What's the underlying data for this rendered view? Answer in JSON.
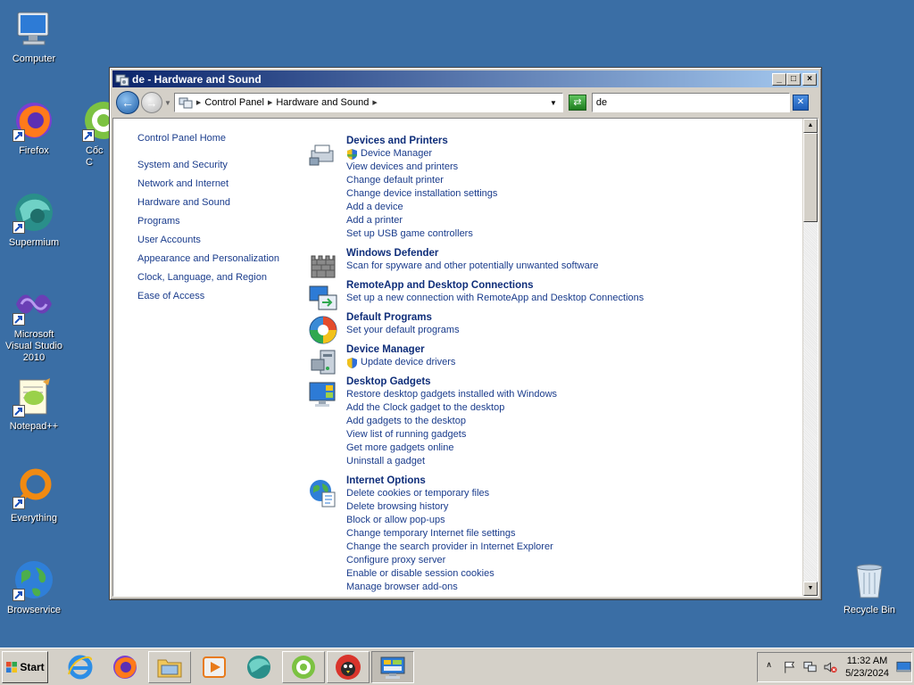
{
  "desktop": {
    "icons": [
      {
        "label": "Computer"
      },
      {
        "label": "Firefox"
      },
      {
        "label": "Cốc C"
      },
      {
        "label": "Supermium"
      },
      {
        "label": "Microsoft Visual Studio 2010"
      },
      {
        "label": "Notepad++"
      },
      {
        "label": "Everything"
      },
      {
        "label": "Browservice"
      },
      {
        "label": "Recycle Bin"
      }
    ]
  },
  "window": {
    "title": "de - Hardware and Sound",
    "controls": {
      "minimize": "_",
      "maximize": "□",
      "close": "×"
    },
    "address": {
      "crumbs": [
        "Control Panel",
        "Hardware and Sound"
      ]
    },
    "search": {
      "value": "de"
    },
    "leftnav": {
      "home": "Control Panel Home",
      "items": [
        "System and Security",
        "Network and Internet",
        "Hardware and Sound",
        "Programs",
        "User Accounts",
        "Appearance and Personalization",
        "Clock, Language, and Region",
        "Ease of Access"
      ]
    },
    "results": [
      {
        "title": "Devices and Printers",
        "icon": "printer-icon",
        "tasks": [
          {
            "label": "Device Manager",
            "shield": true
          },
          {
            "label": "View devices and printers"
          },
          {
            "label": "Change default printer"
          },
          {
            "label": "Change device installation settings"
          },
          {
            "label": "Add a device"
          },
          {
            "label": "Add a printer"
          },
          {
            "label": "Set up USB game controllers"
          }
        ]
      },
      {
        "title": "Windows Defender",
        "icon": "castle-wall-icon",
        "tasks": [
          {
            "label": "Scan for spyware and other potentially unwanted software"
          }
        ]
      },
      {
        "title": "RemoteApp and Desktop Connections",
        "icon": "remote-desktop-icon",
        "tasks": [
          {
            "label": "Set up a new connection with RemoteApp and Desktop Connections"
          }
        ]
      },
      {
        "title": "Default Programs",
        "icon": "default-programs-icon",
        "tasks": [
          {
            "label": "Set your default programs"
          }
        ]
      },
      {
        "title": "Device Manager",
        "icon": "device-manager-icon",
        "tasks": [
          {
            "label": "Update device drivers",
            "shield": true
          }
        ]
      },
      {
        "title": "Desktop Gadgets",
        "icon": "gadgets-icon",
        "tasks": [
          {
            "label": "Restore desktop gadgets installed with Windows"
          },
          {
            "label": "Add the Clock gadget to the desktop"
          },
          {
            "label": "Add gadgets to the desktop"
          },
          {
            "label": "View list of running gadgets"
          },
          {
            "label": "Get more gadgets online"
          },
          {
            "label": "Uninstall a gadget"
          }
        ]
      },
      {
        "title": "Internet Options",
        "icon": "internet-options-icon",
        "tasks": [
          {
            "label": "Delete cookies or temporary files"
          },
          {
            "label": "Delete browsing history"
          },
          {
            "label": "Block or allow pop-ups"
          },
          {
            "label": "Change temporary Internet file settings"
          },
          {
            "label": "Change the search provider in Internet Explorer"
          },
          {
            "label": "Configure proxy server"
          },
          {
            "label": "Enable or disable session cookies"
          },
          {
            "label": "Manage browser add-ons"
          }
        ]
      }
    ]
  },
  "taskbar": {
    "start_label": "Start",
    "apps": [
      "ie-icon",
      "firefox-icon",
      "explorer-icon",
      "media-player-icon",
      "supermium-icon",
      "coc-coc-icon",
      "bird-app-icon",
      "control-panel-icon"
    ],
    "clock": {
      "time": "11:32 AM",
      "date": "5/23/2024"
    }
  },
  "colors": {
    "desktop": "#3a6ea5",
    "link": "#1a3c8c",
    "heading": "#0f2e7a",
    "titlebar_start": "#0a246a",
    "titlebar_end": "#a6caf0"
  }
}
